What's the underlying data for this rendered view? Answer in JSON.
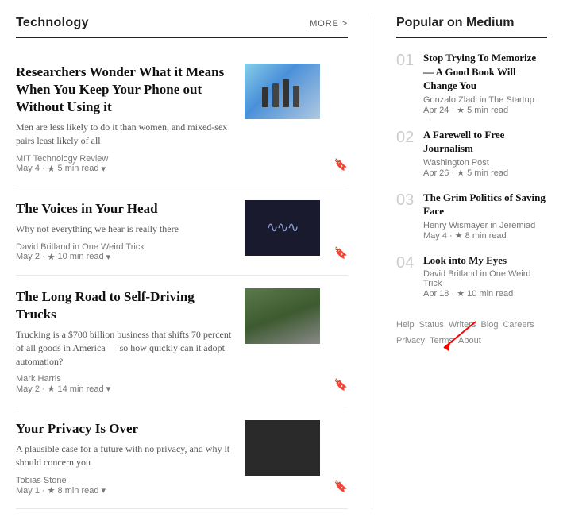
{
  "main": {
    "section_title": "Technology",
    "more_label": "MORE >",
    "articles": [
      {
        "id": "art1",
        "title": "Researchers Wonder What it Means When You Keep Your Phone out Without Using it",
        "subtitle": "Men are less likely to do it than women, and mixed-sex pairs least likely of all",
        "pub_name": "MIT Technology Review",
        "date": "May 4",
        "read_time": "5 min read",
        "image_class": "img1"
      },
      {
        "id": "art2",
        "title": "The Voices in Your Head",
        "subtitle": "Why not everything we hear is really there",
        "pub_name": "David Britland in One Weird Trick",
        "date": "May 2",
        "read_time": "10 min read",
        "image_class": "img2"
      },
      {
        "id": "art3",
        "title": "The Long Road to Self-Driving Trucks",
        "subtitle": "Trucking is a $700 billion business that shifts 70 percent of all goods in America — so how quickly can it adopt automation?",
        "pub_name": "Mark Harris",
        "date": "May 2",
        "read_time": "14 min read",
        "image_class": "img3"
      },
      {
        "id": "art4",
        "title": "Your Privacy Is Over",
        "subtitle": "A plausible case for a future with no privacy, and why it should concern you",
        "pub_name": "Tobias Stone",
        "date": "May 1",
        "read_time": "8 min read",
        "image_class": "img4"
      }
    ]
  },
  "sidebar": {
    "title": "Popular on Medium",
    "items": [
      {
        "num": "01",
        "title": "Stop Trying To Memorize — A Good Book Will Change You",
        "meta": "Gonzalo Zladi in The Startup",
        "date": "Apr 24",
        "read_time": "5 min read"
      },
      {
        "num": "02",
        "title": "A Farewell to Free Journalism",
        "meta": "Washington Post",
        "date": "Apr 26",
        "read_time": "5 min read"
      },
      {
        "num": "03",
        "title": "The Grim Politics of Saving Face",
        "meta": "Henry Wismayer in Jeremiad",
        "date": "May 4",
        "read_time": "8 min read"
      },
      {
        "num": "04",
        "title": "Look into My Eyes",
        "meta": "David Britland in One Weird Trick",
        "date": "Apr 18",
        "read_time": "10 min read"
      }
    ],
    "footer": {
      "links": [
        "Help",
        "Status",
        "Writers",
        "Blog",
        "Careers",
        "Privacy",
        "Terms",
        "About"
      ]
    }
  }
}
